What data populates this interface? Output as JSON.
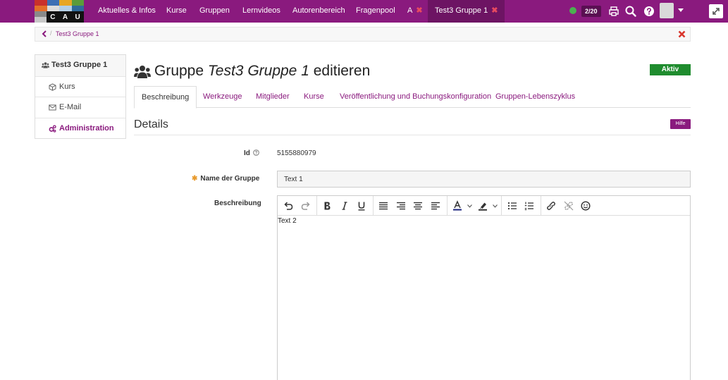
{
  "logo": {
    "letters": [
      "C",
      "A",
      "U"
    ]
  },
  "nav": {
    "items": [
      "Aktuelles & Infos",
      "Kurse",
      "Gruppen",
      "Lernvideos",
      "Autorenbereich",
      "Fragenpool"
    ],
    "tab_a": "A",
    "tab_active": "Test3 Gruppe 1",
    "close_mark": "✖"
  },
  "header": {
    "counter": "2/20"
  },
  "breadcrumb": {
    "sep": "/",
    "current": "Test3 Gruppe 1"
  },
  "sidebar": {
    "items": [
      "Test3 Gruppe 1",
      "Kurs",
      "E-Mail",
      "Administration"
    ]
  },
  "page": {
    "title_prefix": "Gruppe ",
    "title_name": "Test3 Gruppe 1",
    "title_suffix": " editieren",
    "status": "Aktiv"
  },
  "tabs": [
    "Beschreibung",
    "Werkzeuge",
    "Mitglieder",
    "Kurse",
    "Veröffentlichung und Buchungskonfiguration",
    "Gruppen-Lebenszyklus"
  ],
  "details": {
    "title": "Details",
    "help": "Hilfe",
    "id_label": "Id",
    "id_value": "5155880979",
    "name_label": "Name der Gruppe",
    "name_value": "Text 1",
    "required_mark": "✱",
    "desc_label": "Beschreibung",
    "desc_value": "Text 2"
  },
  "colors": {
    "brand": "#8a1a7e",
    "active_tab": "#6d1463",
    "status_green": "#1f8c2e",
    "close_red": "#d9342b"
  }
}
